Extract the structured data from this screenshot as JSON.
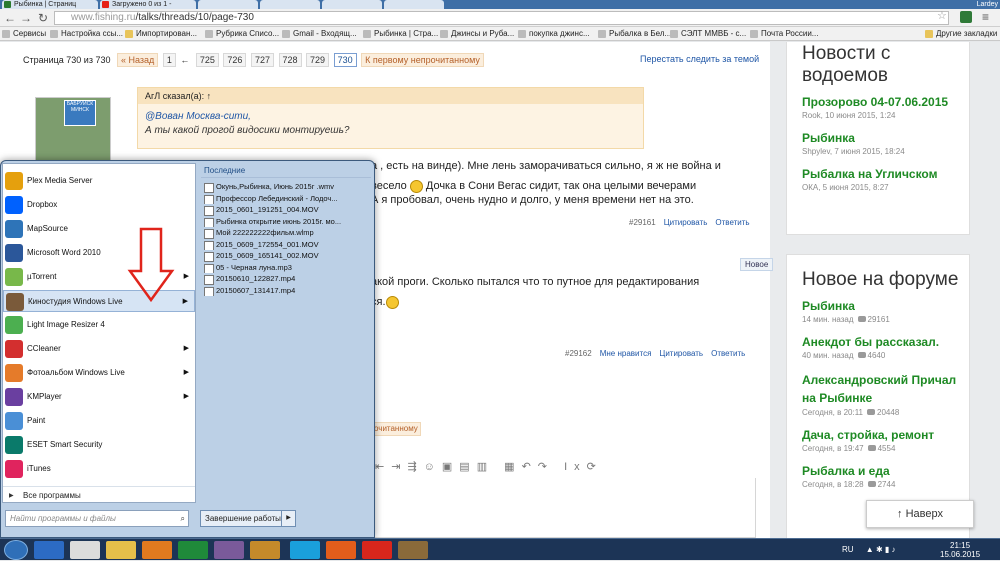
{
  "browser": {
    "tabs": [
      "Рыбинка | Страниц",
      "Загружено 0 из 1 -",
      "",
      "",
      "",
      ""
    ],
    "window_user": "Lardey",
    "url_scheme": "www.fishing.ru",
    "url_path": "/talks/threads/10/page-730"
  },
  "bookmarks": [
    "Сервисы",
    "Настройка ссы...",
    "Импортирован...",
    "Рубрика Списо...",
    "Gmail - Входящ...",
    "Рыбинка | Стра...",
    "Джинсы и Руба...",
    "покупка джинс...",
    "Рыбалка в Бел...",
    "СЭЛТ ММВБ - с...",
    "Почта России...",
    "Другие закладки"
  ],
  "thread": {
    "page_label": "Страница 730 из 730",
    "prev": "« Назад",
    "first": "1",
    "ellipsis": "←",
    "pages": [
      "725",
      "726",
      "727",
      "728",
      "729",
      "730"
    ],
    "first_unread": "К первому непрочитанному",
    "unwatch": "Перестать следить за темой",
    "avatar_sign": "БАБРУЙСК МИНСК",
    "quote_author": "АгЛ сказал(а): ↑",
    "quote_mention": "@Вован Москва-сити,",
    "quote_text": "А ты какой прогой видосики монтируешь?",
    "post1_line1": "а , есть на винде). Мне лень заморачиваться сильно, я ж не война и",
    "post1_line2a": "весело",
    "post1_line2b": "Дочка в Сони Вегас сидит, так она целыми вечерами",
    "post1_line3": "А я пробовал, очень нудно и долго, у меня времени нет на это.",
    "post1_num": "#29161",
    "quote_btn": "Цитировать",
    "reply_btn": "Ответить",
    "new_badge": "Новое",
    "post2_line1": "акой проги. Сколько пытался что то путное для редактирования",
    "post2_line2": "ся.",
    "post2_num": "#29162",
    "like_btn": "Мне нравится",
    "first_unread_2": "очитанному"
  },
  "sidebar": {
    "news_title": "Новости с водоемов",
    "news": [
      {
        "title": "Прозорово 04-07.06.2015",
        "meta": "Rook, 10 июня 2015, 1:24"
      },
      {
        "title": "Рыбинка",
        "meta": "Shpylev, 7 июня 2015, 18:24"
      },
      {
        "title": "Рыбалка на Угличском",
        "meta": "ОКА, 5 июня 2015, 8:27"
      }
    ],
    "forum_title": "Новое на форуме",
    "forum": [
      {
        "title": "Рыбинка",
        "time": "14 мин. назад",
        "count": "29161"
      },
      {
        "title": "Анекдот бы рассказал.",
        "time": "40 мин. назад",
        "count": "4640"
      },
      {
        "title": "Александровский Причал на Рыбинке",
        "time": "Сегодня, в 20:11",
        "count": "20448"
      },
      {
        "title": "Дача, стройка, ремонт",
        "time": "Сегодня, в 19:47",
        "count": "4554"
      },
      {
        "title": "Рыбалка и еда",
        "time": "Сегодня, в 18:28",
        "count": "2744"
      }
    ],
    "up_button": "↑ Наверх"
  },
  "startmenu": {
    "programs": [
      {
        "label": "Plex Media Server",
        "color": "#e5a00d",
        "arrow": false
      },
      {
        "label": "Dropbox",
        "color": "#0061fe",
        "arrow": false
      },
      {
        "label": "MapSource",
        "color": "#2e74b8",
        "arrow": false
      },
      {
        "label": "Microsoft Word 2010",
        "color": "#2b579a",
        "arrow": false
      },
      {
        "label": "µTorrent",
        "color": "#78b84a",
        "arrow": true
      },
      {
        "label": "Киностудия Windows Live",
        "color": "#7a5a3a",
        "arrow": true
      },
      {
        "label": "Light Image Resizer 4",
        "color": "#4caf50",
        "arrow": false
      },
      {
        "label": "CCleaner",
        "color": "#d32f2f",
        "arrow": true
      },
      {
        "label": "Фотоальбом Windows Live",
        "color": "#e57b2a",
        "arrow": true
      },
      {
        "label": "KMPlayer",
        "color": "#6a3fa0",
        "arrow": true
      },
      {
        "label": "Paint",
        "color": "#4a8fd6",
        "arrow": false
      },
      {
        "label": "ESET Smart Security",
        "color": "#0a7a6a",
        "arrow": false
      },
      {
        "label": "iTunes",
        "color": "#e0245e",
        "arrow": false
      }
    ],
    "all_programs": "Все программы",
    "recent_header": "Последние",
    "recent": [
      "Окунь,Рыбинка, Июнь 2015г .wmv",
      "Профессор Лебединский - Лодоч...",
      "2015_0601_191251_004.MOV",
      "Рыбинка открытие июнь 2015г. мо...",
      "Мой 222222222фильм.wlmp",
      "2015_0609_172554_001.MOV",
      "2015_0609_165141_002.MOV",
      "05 - Черная луна.mp3",
      "20150610_122827.mp4",
      "20150607_131417.mp4"
    ],
    "search_placeholder": "Найти программы и файлы",
    "shutdown": "Завершение работы"
  },
  "taskbar": {
    "lang": "RU",
    "time": "21:15",
    "date": "15.06.2015"
  }
}
